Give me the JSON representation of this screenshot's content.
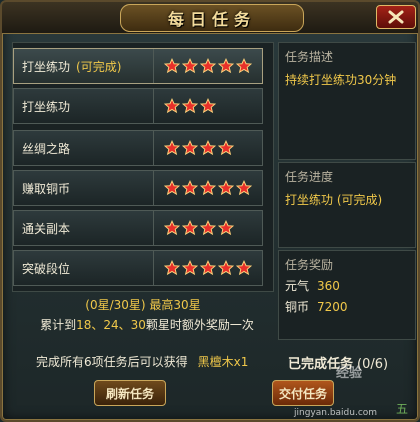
{
  "window": {
    "title": "每日任务",
    "close_icon": "close-x-icon"
  },
  "tasks": [
    {
      "name": "打坐练功",
      "status": "(可完成)",
      "stars": 5
    },
    {
      "name": "打坐练功",
      "status": "",
      "stars": 3
    },
    {
      "name": "丝绸之路",
      "status": "",
      "stars": 4
    },
    {
      "name": "赚取铜币",
      "status": "",
      "stars": 5
    },
    {
      "name": "通关副本",
      "status": "",
      "stars": 4
    },
    {
      "name": "突破段位",
      "status": "",
      "stars": 5
    }
  ],
  "description": {
    "heading": "任务描述",
    "text": "持续打坐练功30分钟"
  },
  "progress": {
    "heading": "任务进度",
    "task": "打坐练功",
    "status": "(可完成)"
  },
  "rewards": {
    "heading": "任务奖励",
    "items": [
      {
        "label": "元气",
        "value": "360"
      },
      {
        "label": "铜币",
        "value": "7200"
      }
    ]
  },
  "summary": {
    "stars_line": "(0星/30星) 最高30星",
    "bonus_prefix": "累计到",
    "bonus_values": "18、24、30",
    "bonus_suffix": "颗星时额外奖励一次",
    "all_complete_text": "完成所有6项任务后可以获得",
    "all_complete_item": "黑檀木x1",
    "completed_label": "已完成任务",
    "completed_count": "(0/6)"
  },
  "buttons": {
    "refresh": "刷新任务",
    "submit": "交付任务"
  },
  "watermark": {
    "text": "经验",
    "url": "jingyan.baidu.com"
  },
  "corner_text": "五",
  "colors": {
    "gold": "#f0c84a",
    "star": "#e8302a",
    "frame": "#8a7440"
  }
}
